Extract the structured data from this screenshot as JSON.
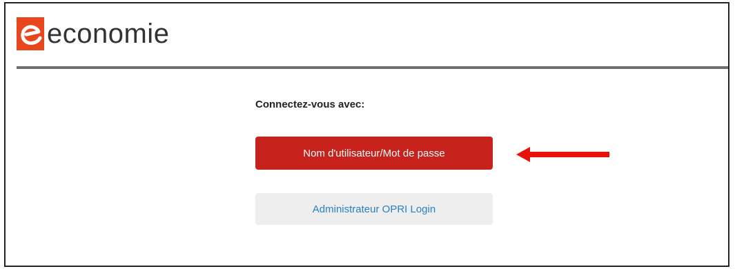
{
  "header": {
    "logo_text": "economie",
    "logo_icon": "economie-e-logo"
  },
  "login": {
    "prompt": "Connectez-vous avec:",
    "primary_button": "Nom d'utilisateur/Mot de passe",
    "secondary_button": "Administrateur OPRI Login"
  },
  "annotation": {
    "arrow_icon": "arrow-left-icon",
    "arrow_color": "#e8120c"
  },
  "colors": {
    "primary": "#c8221c",
    "link": "#2a7fc1",
    "secondary_bg": "#eeeeee",
    "divider": "#6f6f6f"
  }
}
